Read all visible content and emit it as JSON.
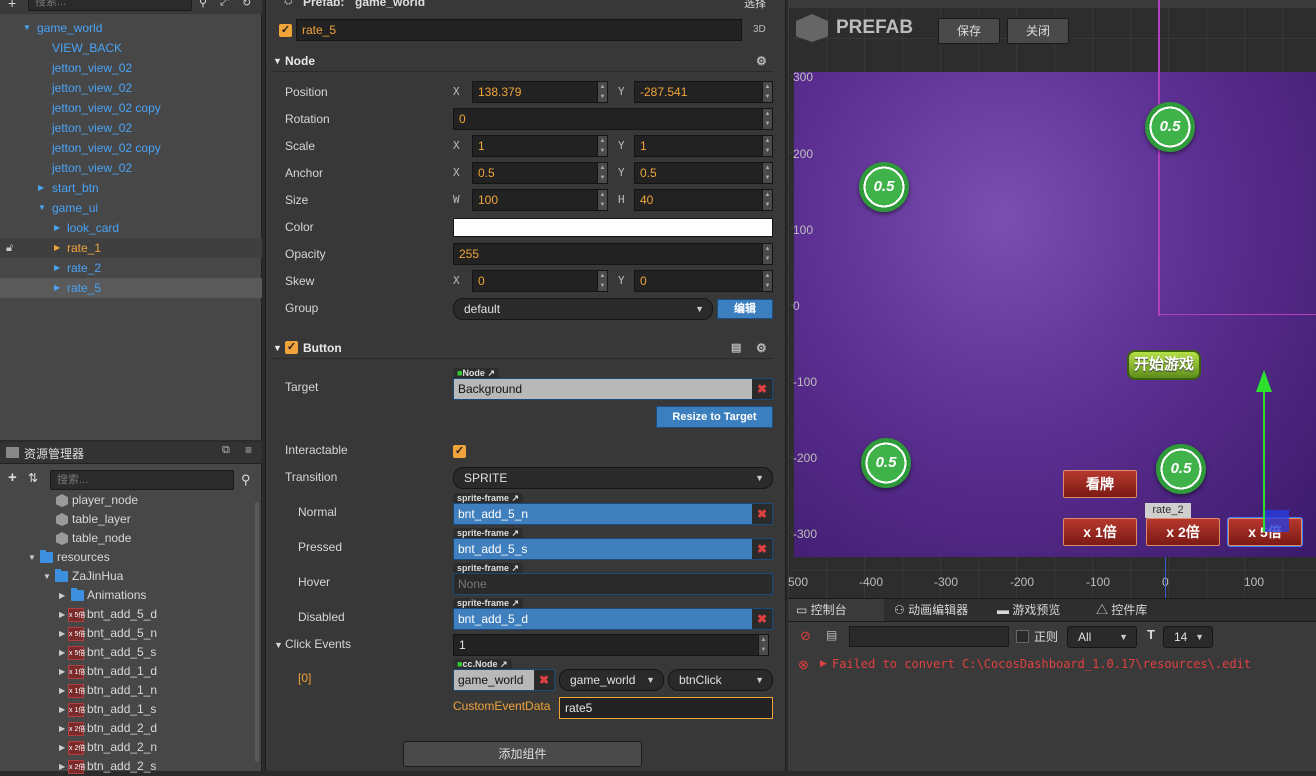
{
  "hierarchy": {
    "search_placeholder": "搜索...",
    "items": [
      {
        "label": "game_world",
        "arrow": "▼"
      },
      {
        "label": "VIEW_BACK"
      },
      {
        "label": "jetton_view_02"
      },
      {
        "label": "jetton_view_02"
      },
      {
        "label": "jetton_view_02 copy"
      },
      {
        "label": "jetton_view_02"
      },
      {
        "label": "jetton_view_02 copy"
      },
      {
        "label": "jetton_view_02"
      },
      {
        "label": "start_btn",
        "arrow": "▶"
      },
      {
        "label": "game_ui",
        "arrow": "▼"
      },
      {
        "label": "look_card",
        "arrow": "▶"
      },
      {
        "label": "rate_1",
        "arrow": "▶"
      },
      {
        "label": "rate_2",
        "arrow": "▶"
      },
      {
        "label": "rate_5",
        "arrow": "▶"
      }
    ]
  },
  "assets": {
    "title": "资源管理器",
    "search_placeholder": "搜索...",
    "items": [
      {
        "label": "player_node"
      },
      {
        "label": "table_layer"
      },
      {
        "label": "table_node"
      },
      {
        "label": "resources"
      },
      {
        "label": "ZaJinHua"
      },
      {
        "label": "Animations"
      },
      {
        "label": "bnt_add_5_d",
        "thumb": "x 5倍"
      },
      {
        "label": "bnt_add_5_n",
        "thumb": "x 5倍"
      },
      {
        "label": "bnt_add_5_s",
        "thumb": "x 5倍"
      },
      {
        "label": "btn_add_1_d",
        "thumb": "x 1倍"
      },
      {
        "label": "btn_add_1_n",
        "thumb": "x 1倍"
      },
      {
        "label": "btn_add_1_s",
        "thumb": "x 1倍"
      },
      {
        "label": "btn_add_2_d",
        "thumb": "x 2倍"
      },
      {
        "label": "btn_add_2_n",
        "thumb": "x 2倍"
      },
      {
        "label": "btn_add_2_s",
        "thumb": "x 2倍"
      }
    ]
  },
  "inspector": {
    "prefab_label": "Prefab:",
    "prefab_name": "game_world",
    "select_label": "选择",
    "node_name": "rate_5",
    "badge_3d": "3D",
    "node_section": "Node",
    "position": {
      "label": "Position",
      "x_axis": "X",
      "x": "138.379",
      "y_axis": "Y",
      "y": "-287.541"
    },
    "rotation": {
      "label": "Rotation",
      "value": "0"
    },
    "scale": {
      "label": "Scale",
      "x_axis": "X",
      "x": "1",
      "y_axis": "Y",
      "y": "1"
    },
    "anchor": {
      "label": "Anchor",
      "x_axis": "X",
      "x": "0.5",
      "y_axis": "Y",
      "y": "0.5"
    },
    "size": {
      "label": "Size",
      "w_axis": "W",
      "w": "100",
      "h_axis": "H",
      "h": "40"
    },
    "color": {
      "label": "Color",
      "value": "#ffffff"
    },
    "opacity": {
      "label": "Opacity",
      "value": "255"
    },
    "skew": {
      "label": "Skew",
      "x_axis": "X",
      "x": "0",
      "y_axis": "Y",
      "y": "0"
    },
    "group": {
      "label": "Group",
      "value": "default",
      "edit": "编辑"
    },
    "button_section": "Button",
    "target": {
      "label": "Target",
      "tag": "Node",
      "value": "Background"
    },
    "resize": "Resize to Target",
    "interactable": {
      "label": "Interactable",
      "checked": true
    },
    "transition": {
      "label": "Transition",
      "value": "SPRITE"
    },
    "normal": {
      "label": "Normal",
      "tag": "sprite-frame",
      "value": "bnt_add_5_n"
    },
    "pressed": {
      "label": "Pressed",
      "tag": "sprite-frame",
      "value": "bnt_add_5_s"
    },
    "hover": {
      "label": "Hover",
      "tag": "sprite-frame",
      "value": "None"
    },
    "disabled": {
      "label": "Disabled",
      "tag": "sprite-frame",
      "value": "bnt_add_5_d"
    },
    "click_events": {
      "label": "Click Events",
      "count": "1"
    },
    "event0": {
      "index": "[0]",
      "tag": "cc.Node",
      "node": "game_world",
      "component": "game_world",
      "handler": "btnClick",
      "custom_label": "CustomEventData",
      "custom_value": "rate5"
    },
    "add_component": "添加组件"
  },
  "scene": {
    "logo": "PREFAB",
    "save": "保存",
    "close": "关闭",
    "y_ticks": [
      "300",
      "200",
      "100",
      "0",
      "-100",
      "-200",
      "-300"
    ],
    "x_ticks": [
      "500",
      "-400",
      "-300",
      "-200",
      "-100",
      "0",
      "100"
    ],
    "chips": [
      "0.5",
      "0.5",
      "0.5",
      "0.5"
    ],
    "start_btn": "开始游戏",
    "look_btn": "看牌",
    "rate_tooltip": "rate_2",
    "rate_btns": [
      "x 1倍",
      "x 2倍",
      "x 5倍"
    ]
  },
  "console": {
    "tabs": [
      "控制台",
      "动画编辑器",
      "游戏预览",
      "控件库"
    ],
    "regex_label": "正则",
    "level": "All",
    "font_size": "14",
    "error": "Failed to convert C:\\CocosDashboard_1.0.17\\resources\\.edit"
  }
}
